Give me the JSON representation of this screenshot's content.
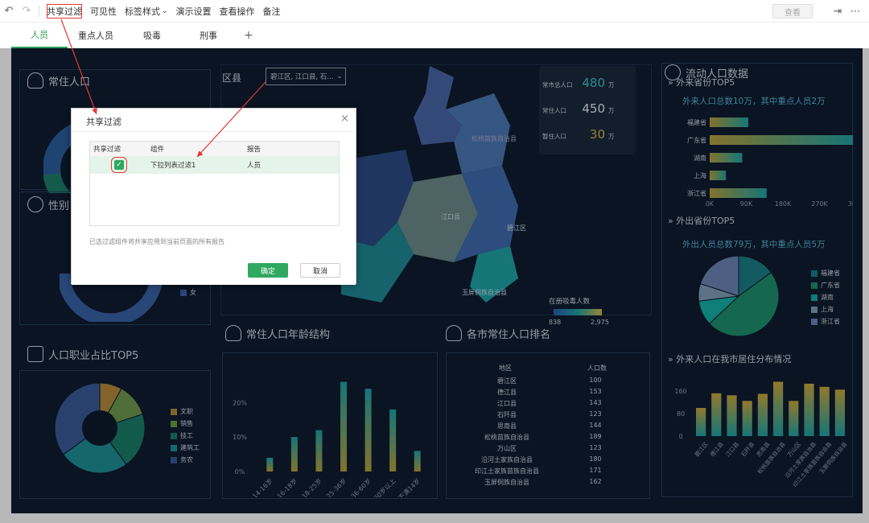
{
  "toolbar": {
    "undo_icon": "undo-icon",
    "redo_icon": "redo-icon",
    "items": [
      "共享过滤",
      "可见性",
      "标签样式",
      "演示设置",
      "查看操作",
      "备注"
    ],
    "chevron": "⌄",
    "view_button": "查看",
    "right_icons": [
      "export-icon",
      "more-icon"
    ]
  },
  "tabs": [
    "人员",
    "重点人员",
    "吸毒",
    "刑事"
  ],
  "add_tab": "+",
  "panels": {
    "resident_title": "常住人口",
    "gender_title": "性别",
    "gender_legend": "女",
    "occupation_title": "人口职业占比TOP5",
    "occupation_legend": [
      "文职",
      "销售",
      "技工",
      "建筑工",
      "务农"
    ],
    "district_title": "区县",
    "district_select": "碧江区, 江口县, 石...",
    "map_labels": [
      "松桃苗族自治县",
      "江口县",
      "碧江区",
      "玉屏侗族自治县"
    ],
    "stats": [
      {
        "label": "常市总人口",
        "value": "480",
        "unit": "万"
      },
      {
        "label": "常住人口",
        "value": "450",
        "unit": "万"
      },
      {
        "label": "暂住人口",
        "value": "30",
        "unit": "万"
      }
    ],
    "map_legend_title": "在册吸毒人数",
    "map_legend_min": "838",
    "map_legend_max": "2,975",
    "age_title": "常住人口年龄结构",
    "rank_title": "各市常住人口排名",
    "rank_headers": [
      "地区",
      "人口数"
    ],
    "float_title": "流动人口数据",
    "inflow_title": "外来省份TOP5",
    "inflow_summary": "外来人口总数10万，其中重点人员2万",
    "outflow_title": "外出省份TOP5",
    "outflow_summary": "外出人员总数79万，其中重点人员5万",
    "outflow_legend": [
      "福建省",
      "广东省",
      "湖南",
      "上海",
      "浙江省"
    ],
    "distribution_title": "外来人口在我市居住分布情况"
  },
  "chart_data": [
    {
      "type": "bar",
      "title": "常住人口年龄结构",
      "categories": [
        "14-16岁",
        "16-18岁",
        "18-25岁",
        "25-36岁",
        "36-60岁",
        "60岁以上",
        "不满14岁"
      ],
      "values": [
        4,
        10,
        12,
        26,
        24,
        18,
        6
      ],
      "ylim": [
        0,
        28
      ],
      "ytick_labels": [
        "0%",
        "10%",
        "20%"
      ],
      "yticks": [
        0,
        10,
        20
      ]
    },
    {
      "type": "table",
      "title": "各市常住人口排名",
      "columns": [
        "地区",
        "人口数"
      ],
      "rows": [
        [
          "碧江区",
          "100"
        ],
        [
          "德江县",
          "153"
        ],
        [
          "江口县",
          "143"
        ],
        [
          "石阡县",
          "123"
        ],
        [
          "思南县",
          "144"
        ],
        [
          "松桃苗族自治县",
          "189"
        ],
        [
          "万山区",
          "123"
        ],
        [
          "沿河土家族自治县",
          "180"
        ],
        [
          "印江土家族苗族自治县",
          "171"
        ],
        [
          "玉屏侗族自治县",
          "162"
        ]
      ]
    },
    {
      "type": "bar",
      "orientation": "horizontal",
      "title": "外来省份TOP5",
      "categories": [
        "福建省",
        "广东省",
        "湖南",
        "上海",
        "浙江省"
      ],
      "values": [
        95000,
        360000,
        80000,
        40000,
        140000
      ],
      "xlim": [
        0,
        360000
      ],
      "xtick_labels": [
        "0K",
        "90K",
        "180K",
        "270K",
        "360K"
      ]
    },
    {
      "type": "pie",
      "title": "外出省份TOP5",
      "categories": [
        "福建省",
        "广东省",
        "湖南",
        "上海",
        "浙江省"
      ],
      "values": [
        15,
        48,
        10,
        7,
        20
      ]
    },
    {
      "type": "bar",
      "title": "外来人口在我市居住分布情况",
      "categories": [
        "碧江区",
        "德江县",
        "江口县",
        "石阡县",
        "思南县",
        "松桃苗族自治县",
        "万山区",
        "沿河土家族自治县",
        "印江土家族苗族自治县",
        "玉屏侗族自治县"
      ],
      "values": [
        100,
        152,
        145,
        125,
        150,
        193,
        125,
        186,
        175,
        165
      ],
      "ylim": [
        0,
        200
      ],
      "ytick_labels": [
        "0",
        "80",
        "160"
      ],
      "yticks": [
        0,
        80,
        160
      ]
    },
    {
      "type": "pie",
      "title": "人口职业占比TOP5",
      "categories": [
        "文职",
        "销售",
        "技工",
        "建筑工",
        "务农"
      ],
      "values": [
        8,
        12,
        20,
        25,
        35
      ]
    }
  ],
  "dialog": {
    "title": "共享过滤",
    "close": "×",
    "headers": [
      "共享过滤",
      "组件",
      "报告"
    ],
    "row": {
      "check": "✓",
      "component": "下拉列表过滤1",
      "report": "人员"
    },
    "note": "已选过滤组件将共享应用到当前页面的所有报告",
    "ok": "确定",
    "cancel": "取消"
  },
  "colors": {
    "accent_green": "#2fa860",
    "annotation_red": "#e53935",
    "dash_bg": "#0f1d30"
  }
}
